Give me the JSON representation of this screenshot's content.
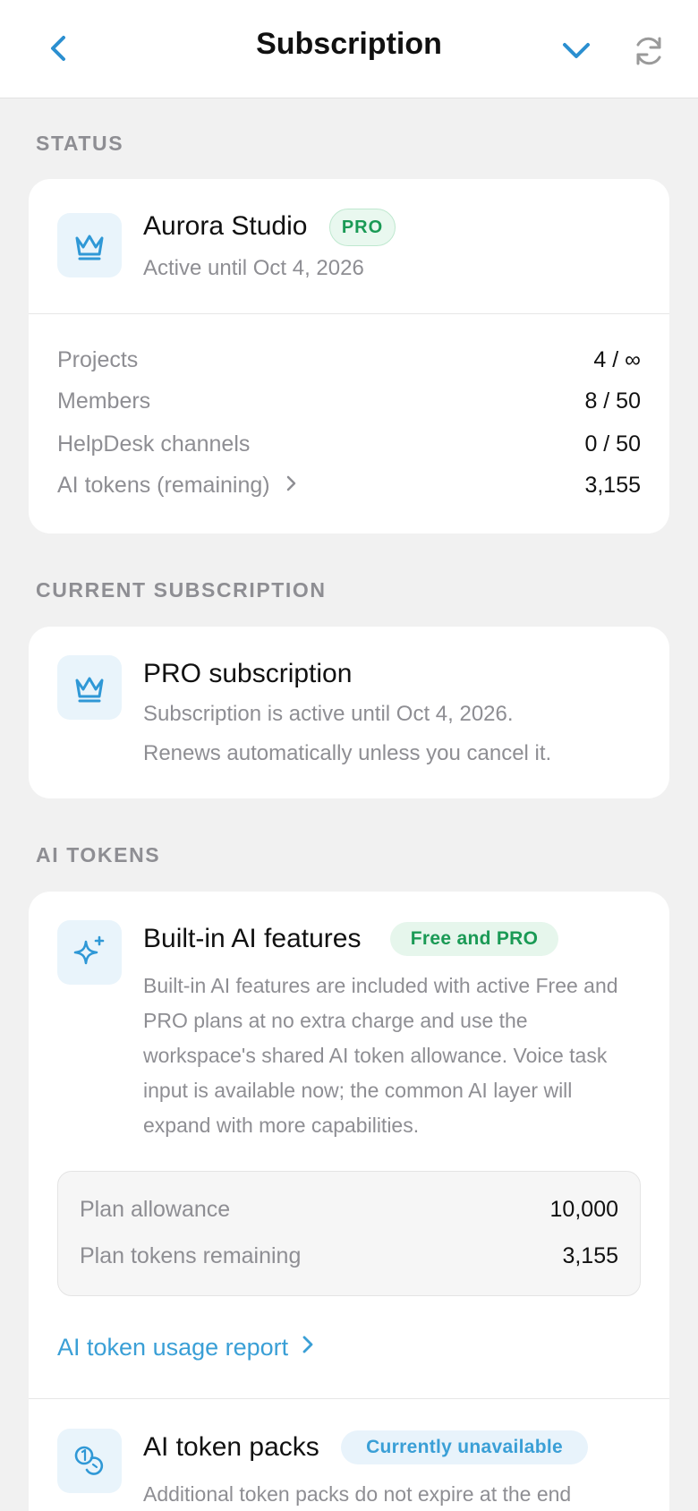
{
  "header": {
    "title": "Subscription"
  },
  "status": {
    "section_label": "STATUS",
    "org_name": "Aurora Studio",
    "badge": "PRO",
    "active_until": "Active until Oct 4, 2026",
    "rows": [
      {
        "label": "Projects",
        "value": "4 / ∞"
      },
      {
        "label": "Members",
        "value": "8 / 50"
      },
      {
        "label": "HelpDesk channels",
        "value": "0 / 50"
      },
      {
        "label": "AI tokens (remaining)",
        "value": "3,155"
      }
    ]
  },
  "current_subscription": {
    "section_label": "CURRENT SUBSCRIPTION",
    "title": "PRO subscription",
    "line1": "Subscription is active until Oct 4, 2026.",
    "line2": "Renews automatically unless you cancel it."
  },
  "ai_tokens": {
    "section_label": "AI TOKENS",
    "builtin": {
      "title": "Built-in AI features",
      "badge": "Free and PRO",
      "description": "Built-in AI features are included with active Free and PRO plans at no extra charge and use the workspace's shared AI token allowance. Voice task input is available now; the common AI layer will expand with more capabilities.",
      "plan_allowance_label": "Plan allowance",
      "plan_allowance_value": "10,000",
      "plan_remaining_label": "Plan tokens remaining",
      "plan_remaining_value": "3,155",
      "report_link": "AI token usage report"
    },
    "packs": {
      "title": "AI token packs",
      "badge": "Currently unavailable",
      "description": "Additional token packs do not expire at the end"
    }
  },
  "colors": {
    "accent": "#3a9fd6",
    "green": "#1a9a55",
    "muted": "#8e8e93"
  }
}
